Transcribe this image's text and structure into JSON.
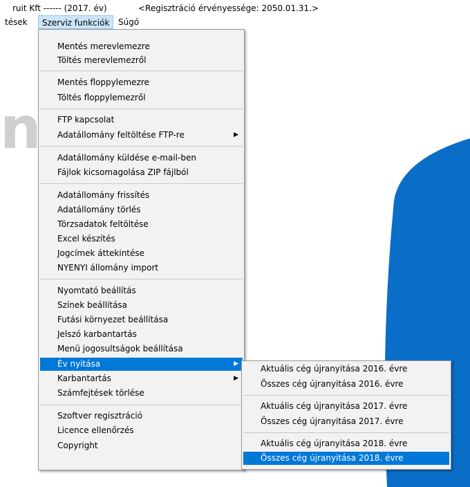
{
  "titlebar": {
    "company": "ruit Kft ------ (2017. év)",
    "registration": "<Regisztráció érvényessége: 2050.01.31.>"
  },
  "menubar": {
    "items": [
      "tések",
      "Szerviz funkciók",
      "Súgó"
    ]
  },
  "background": {
    "letters": "nt",
    "blue": "#0a6ec8"
  },
  "service_menu": {
    "items": [
      "Mentés merevlemezre",
      "Töltés merevlemezről",
      "Mentés floppylemezre",
      "Töltés floppylemezről",
      "FTP kapcsolat",
      "Adatállomány feltöltése FTP-re",
      "Adatállomány küldése e-mail-ben",
      "Fájlok kicsomagolása ZIP fájlból",
      "Adatállomány frissítés",
      "Adatállomány törlés",
      "Törzsadatok feltöltése",
      "Excel készítés",
      "Jogcímek áttekintése",
      "NYENYI állomány import",
      "Nyomtató beállítás",
      "Színek beállítása",
      "Futási környezet beállítása",
      "Jelszó karbantartás",
      "Menü jogosultságok beállítása",
      "Év nyitása",
      "Karbantartás",
      "Számfejtések törlése",
      "Szoftver regisztráció",
      "Licence ellenőrzés",
      "Copyright"
    ],
    "selected": "Év nyitása"
  },
  "year_open_submenu": {
    "items": [
      "Aktuális cég újranyitása 2016. évre",
      "Összes cég újranyitása 2016. évre",
      "Aktuális cég újranyitása 2017. évre",
      "Összes cég újranyitása 2017. évre",
      "Aktuális cég újranyitása 2018. évre",
      "Összes cég újranyitása 2018. évre"
    ],
    "highlighted": "Összes cég újranyitása 2018. évre"
  },
  "colors": {
    "highlight": "#0078d7",
    "menu_bg": "#f2f2f2",
    "menubar_active": "#cce4f7"
  },
  "icons": {
    "submenu_arrow": "triangle-right"
  }
}
